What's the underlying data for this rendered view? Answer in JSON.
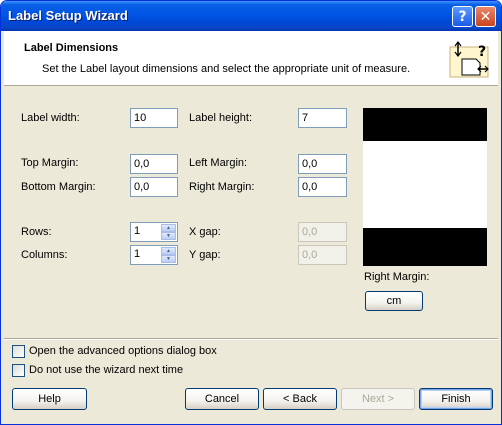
{
  "window": {
    "title": "Label Setup Wizard",
    "help_glyph": "?",
    "close_glyph": "✕"
  },
  "header": {
    "title": "Label Dimensions",
    "subtitle": "Set the Label layout dimensions and select the appropriate unit of measure."
  },
  "fields": {
    "label_width": {
      "label": "Label width:",
      "value": "10"
    },
    "label_height": {
      "label": "Label height:",
      "value": "7"
    },
    "top_margin": {
      "label": "Top Margin:",
      "value": "0,0"
    },
    "left_margin": {
      "label": "Left Margin:",
      "value": "0,0"
    },
    "bottom_margin": {
      "label": "Bottom Margin:",
      "value": "0,0"
    },
    "right_margin": {
      "label": "Right Margin:",
      "value": "0,0"
    },
    "rows": {
      "label": "Rows:",
      "value": "1"
    },
    "columns": {
      "label": "Columns:",
      "value": "1"
    },
    "x_gap": {
      "label": "X gap:",
      "value": "0,0"
    },
    "y_gap": {
      "label": "Y gap:",
      "value": "0,0"
    }
  },
  "preview": {
    "caption": "Right Margin:",
    "unit_button": "cm"
  },
  "options": {
    "advanced": {
      "label": "Open the advanced options dialog box",
      "checked": false
    },
    "no_wizard": {
      "label": "Do not use the wizard next time",
      "checked": false
    }
  },
  "buttons": {
    "help": "Help",
    "cancel": "Cancel",
    "back": "< Back",
    "next": "Next >",
    "finish": "Finish"
  }
}
